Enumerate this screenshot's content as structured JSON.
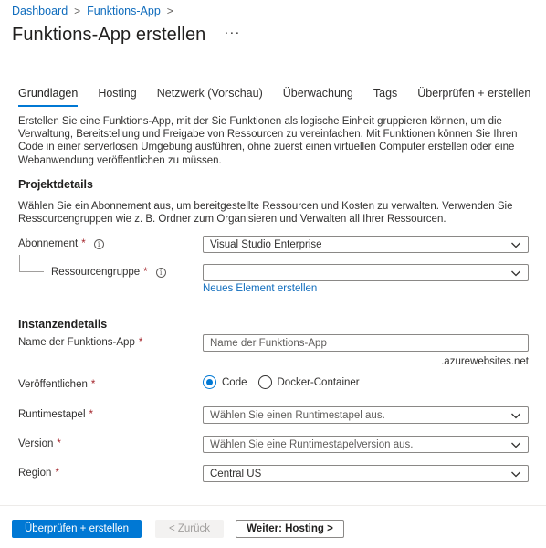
{
  "breadcrumb": {
    "items": [
      "Dashboard",
      "Funktions-App"
    ],
    "separator": ">"
  },
  "header": {
    "title": "Funktions-App erstellen",
    "more": "···"
  },
  "tabs": [
    "Grundlagen",
    "Hosting",
    "Netzwerk (Vorschau)",
    "Überwachung",
    "Tags",
    "Überprüfen + erstellen"
  ],
  "active_tab": "Grundlagen",
  "intro": "Erstellen Sie eine Funktions-App, mit der Sie Funktionen als logische Einheit gruppieren können, um die Verwaltung, Bereitstellung und Freigabe von Ressourcen zu vereinfachen. Mit Funktionen können Sie Ihren Code in einer serverlosen Umgebung ausführen, ohne zuerst einen virtuellen Computer erstellen oder eine Webanwendung veröffentlichen zu müssen.",
  "project": {
    "title": "Projektdetails",
    "description": "Wählen Sie ein Abonnement aus, um bereitgestellte Ressourcen und Kosten zu verwalten. Verwenden Sie Ressourcengruppen wie z. B. Ordner zum Organisieren und Verwalten all Ihrer Ressourcen.",
    "subscription_label": "Abonnement",
    "subscription_value": "Visual Studio Enterprise",
    "resource_group_label": "Ressourcengruppe",
    "resource_group_value": "",
    "create_new_link": "Neues Element erstellen"
  },
  "instance": {
    "title": "Instanzendetails",
    "name_label": "Name der Funktions-App",
    "name_placeholder": "Name der Funktions-App",
    "name_suffix": ".azurewebsites.net",
    "publish_label": "Veröffentlichen",
    "publish_options": [
      "Code",
      "Docker-Container"
    ],
    "publish_selected": "Code",
    "runtime_label": "Runtimestapel",
    "runtime_placeholder": "Wählen Sie einen Runtimestapel aus.",
    "version_label": "Version",
    "version_placeholder": "Wählen Sie eine Runtimestapelversion aus.",
    "region_label": "Region",
    "region_value": "Central US"
  },
  "required_marker": "*",
  "info_symbol": "i",
  "footer": {
    "review_button": "Überprüfen + erstellen",
    "back_button": "< Zurück",
    "next_button": "Weiter: Hosting >"
  },
  "colors": {
    "accent": "#0078d4",
    "link": "#0f6cbd",
    "required": "#a4262c"
  }
}
